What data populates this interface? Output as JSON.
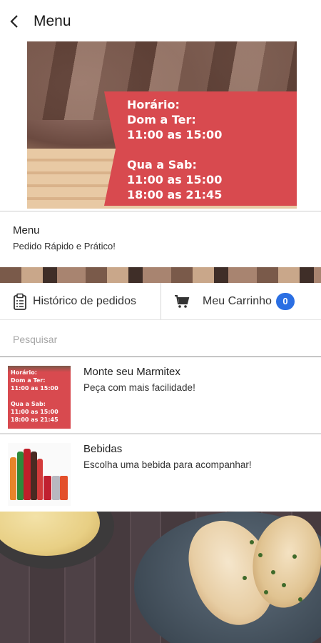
{
  "header": {
    "title": "Menu"
  },
  "banner": {
    "lines_1": [
      "Horário:",
      "Dom a Ter:",
      "11:00 as 15:00"
    ],
    "lines_2": [
      "Qua a Sab:",
      "11:00 as 15:00",
      "18:00 as 21:45"
    ]
  },
  "store": {
    "name": "Menu",
    "tagline": "Pedido Rápido e Prático!"
  },
  "actions": {
    "history_label": "Histórico de pedidos",
    "cart_label": "Meu Carrinho",
    "cart_count": "0"
  },
  "search": {
    "placeholder": "Pesquisar"
  },
  "categories": [
    {
      "title": "Monte seu Marmitex",
      "description": "Peça com mais facilidade!",
      "thumb_text": [
        "Horário:",
        "Dom a Ter:",
        "11:00 as 15:00",
        "",
        "Qua a Sab:",
        "11:00 as 15:00",
        "18:00 as 21:45"
      ]
    },
    {
      "title": "Bebidas",
      "description": "Escolha uma bebida para acompanhar!"
    }
  ],
  "colors": {
    "badge": "#2b6fe3",
    "banner_red": "#d84a4f"
  },
  "icons": {
    "back": "chevron-left-icon",
    "history": "clipboard-icon",
    "cart": "cart-icon"
  }
}
